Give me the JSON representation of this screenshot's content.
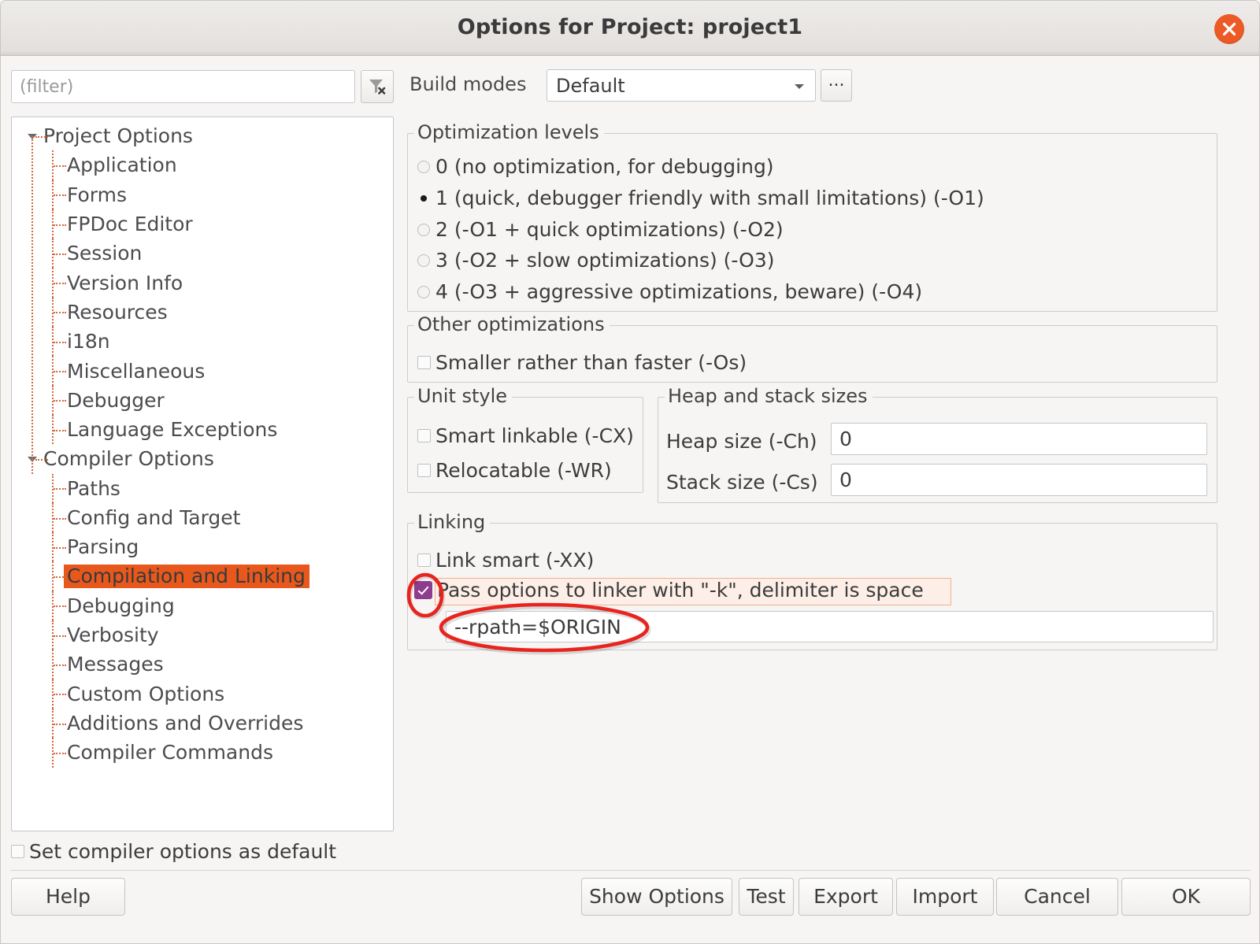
{
  "window": {
    "title": "Options for Project: project1",
    "close_icon": "close-icon"
  },
  "toolbar": {
    "filter_placeholder": "(filter)",
    "filter_value": "",
    "filter_clear_icon": "filter-clear-icon",
    "build_modes_label": "Build modes",
    "build_modes_value": "Default",
    "build_modes_more_label": "..."
  },
  "tree": {
    "nodes": [
      {
        "label": "Project Options",
        "level": 0,
        "expanded": true,
        "selected": false
      },
      {
        "label": "Application",
        "level": 1,
        "expanded": false,
        "selected": false
      },
      {
        "label": "Forms",
        "level": 1,
        "expanded": false,
        "selected": false
      },
      {
        "label": "FPDoc Editor",
        "level": 1,
        "expanded": false,
        "selected": false
      },
      {
        "label": "Session",
        "level": 1,
        "expanded": false,
        "selected": false
      },
      {
        "label": "Version Info",
        "level": 1,
        "expanded": false,
        "selected": false
      },
      {
        "label": "Resources",
        "level": 1,
        "expanded": false,
        "selected": false
      },
      {
        "label": "i18n",
        "level": 1,
        "expanded": false,
        "selected": false
      },
      {
        "label": "Miscellaneous",
        "level": 1,
        "expanded": false,
        "selected": false
      },
      {
        "label": "Debugger",
        "level": 1,
        "expanded": false,
        "selected": false
      },
      {
        "label": "Language Exceptions",
        "level": 1,
        "expanded": false,
        "selected": false
      },
      {
        "label": "Compiler Options",
        "level": 0,
        "expanded": true,
        "selected": false
      },
      {
        "label": "Paths",
        "level": 1,
        "expanded": false,
        "selected": false
      },
      {
        "label": "Config and Target",
        "level": 1,
        "expanded": false,
        "selected": false
      },
      {
        "label": "Parsing",
        "level": 1,
        "expanded": false,
        "selected": false
      },
      {
        "label": "Compilation and Linking",
        "level": 1,
        "expanded": false,
        "selected": true
      },
      {
        "label": "Debugging",
        "level": 1,
        "expanded": false,
        "selected": false
      },
      {
        "label": "Verbosity",
        "level": 1,
        "expanded": false,
        "selected": false
      },
      {
        "label": "Messages",
        "level": 1,
        "expanded": false,
        "selected": false
      },
      {
        "label": "Custom Options",
        "level": 1,
        "expanded": false,
        "selected": false
      },
      {
        "label": "Additions and Overrides",
        "level": 1,
        "expanded": false,
        "selected": false
      },
      {
        "label": "Compiler Commands",
        "level": 1,
        "expanded": false,
        "selected": false
      }
    ]
  },
  "optimization_levels": {
    "title": "Optimization levels",
    "options": [
      {
        "label": "0 (no optimization, for debugging)",
        "checked": false
      },
      {
        "label": "1 (quick, debugger friendly with small limitations) (-O1)",
        "checked": true
      },
      {
        "label": "2 (-O1 + quick optimizations) (-O2)",
        "checked": false
      },
      {
        "label": "3 (-O2 + slow optimizations) (-O3)",
        "checked": false
      },
      {
        "label": "4 (-O3 + aggressive optimizations, beware) (-O4)",
        "checked": false
      }
    ]
  },
  "other_optimizations": {
    "title": "Other optimizations",
    "options": [
      {
        "label": "Smaller rather than faster (-Os)",
        "checked": false
      }
    ]
  },
  "unit_style": {
    "title": "Unit style",
    "options": [
      {
        "label": "Smart linkable (-CX)",
        "checked": false
      },
      {
        "label": "Relocatable (-WR)",
        "checked": false
      }
    ]
  },
  "heap_and_stack": {
    "title": "Heap and stack sizes",
    "heap_label": "Heap size (-Ch)",
    "heap_value": "0",
    "stack_label": "Stack size (-Cs)",
    "stack_value": "0"
  },
  "linking": {
    "title": "Linking",
    "link_smart_label": "Link smart (-XX)",
    "link_smart_checked": false,
    "pass_options_label": "Pass options to linker with \"-k\", delimiter is space",
    "pass_options_checked": true,
    "linker_options_value": "--rpath=$ORIGIN"
  },
  "footer": {
    "set_default_label": "Set compiler options as default",
    "set_default_checked": false,
    "buttons": [
      {
        "label": "Help"
      },
      {
        "label": "Show Options"
      },
      {
        "label": "Test"
      },
      {
        "label": "Export"
      },
      {
        "label": "Import"
      },
      {
        "label": "Cancel"
      },
      {
        "label": "OK"
      }
    ]
  },
  "annotations": {
    "color": "#e8241f",
    "checkbox_ellipse": "annotation-ellipse-checkbox",
    "field_ellipse": "annotation-ellipse-linker-options"
  }
}
